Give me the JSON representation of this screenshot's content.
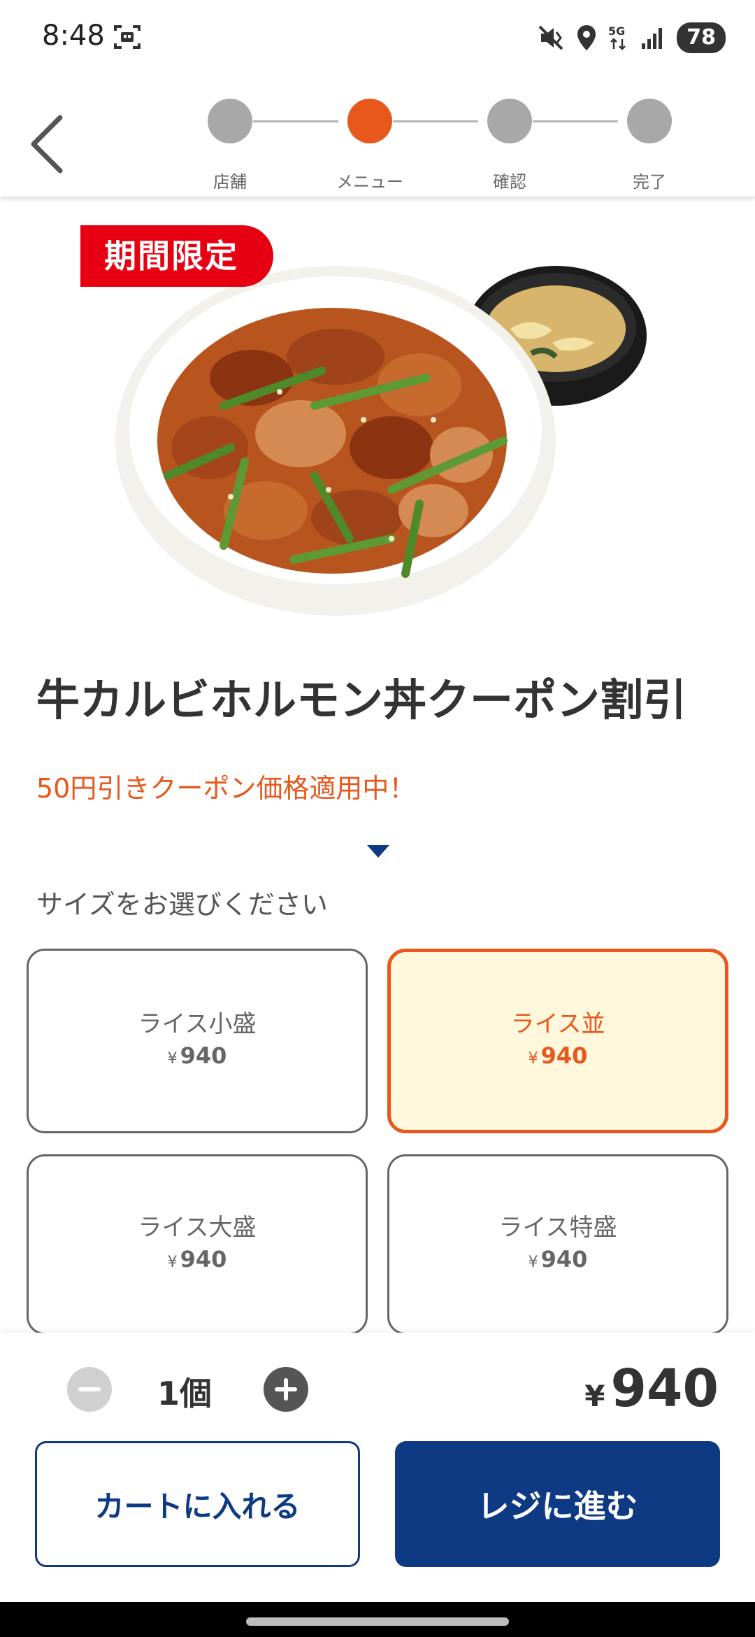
{
  "status_bar": {
    "time": "8:48",
    "battery": "78",
    "icons": [
      "screenshot-icon",
      "mute-icon",
      "location-icon",
      "5g-icon",
      "signal-icon",
      "battery-icon"
    ]
  },
  "stepper": {
    "steps": [
      {
        "label": "店舗",
        "active": false
      },
      {
        "label": "メニュー",
        "active": true
      },
      {
        "label": "確認",
        "active": false
      },
      {
        "label": "完了",
        "active": false
      }
    ]
  },
  "badge": "期間限定",
  "product": {
    "title": "牛カルビホルモン丼クーポン割引",
    "coupon_note": "50円引きクーポン価格適用中！"
  },
  "size_prompt": "サイズをお選びください",
  "sizes": [
    {
      "name": "ライス小盛",
      "yen": "¥",
      "price": "940",
      "selected": false
    },
    {
      "name": "ライス並",
      "yen": "¥",
      "price": "940",
      "selected": true
    },
    {
      "name": "ライス大盛",
      "yen": "¥",
      "price": "940",
      "selected": false
    },
    {
      "name": "ライス特盛",
      "yen": "¥",
      "price": "940",
      "selected": false
    }
  ],
  "quantity": {
    "value": "1個"
  },
  "total": {
    "yen": "¥",
    "amount": "940"
  },
  "buttons": {
    "cart": "カートに入れる",
    "checkout": "レジに進む"
  },
  "colors": {
    "accent": "#e8571c",
    "primary": "#0e3a84",
    "badge": "#e60012",
    "selected_bg": "#fff8dc"
  }
}
